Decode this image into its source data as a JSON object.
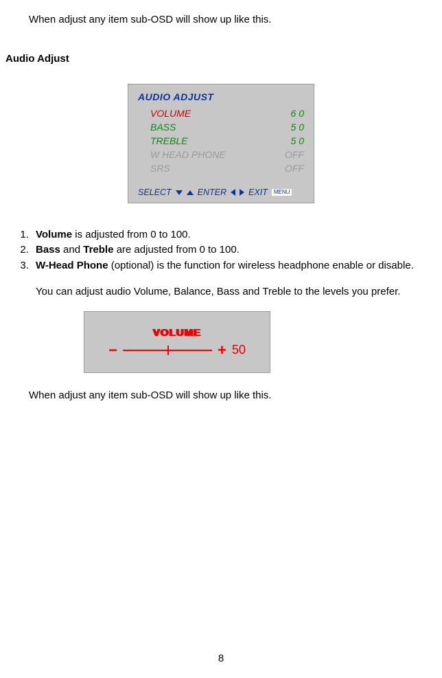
{
  "intro": "When adjust any item sub-OSD will show up like this.",
  "section_heading": "Audio Adjust",
  "osd": {
    "title": "AUDIO ADJUST",
    "rows": [
      {
        "label": "VOLUME",
        "value": "6 0"
      },
      {
        "label": "BASS",
        "value": "5 0"
      },
      {
        "label": "TREBLE",
        "value": "5 0"
      },
      {
        "label": "W HEAD PHONE",
        "value": "OFF"
      },
      {
        "label": "SRS",
        "value": "OFF"
      }
    ],
    "footer": {
      "select": "SELECT",
      "enter": "ENTER",
      "exit": "EXIT",
      "menu": "MENU"
    }
  },
  "list": {
    "item1": {
      "bold": "Volume",
      "rest": " is adjusted from 0 to 100."
    },
    "item2": {
      "bold1": "Bass",
      "mid": " and ",
      "bold2": "Treble",
      "rest": " are adjusted from 0 to 100."
    },
    "item3": {
      "bold": "W-Head Phone",
      "rest": " (optional) is the function for wireless headphone enable or disable."
    }
  },
  "cont": "You can adjust audio Volume, Balance, Bass and Treble to the levels you prefer.",
  "sub_osd": {
    "title": "VOLUME",
    "value": "50"
  },
  "closing": "When adjust any item sub-OSD will show up like this.",
  "page_number": "8"
}
